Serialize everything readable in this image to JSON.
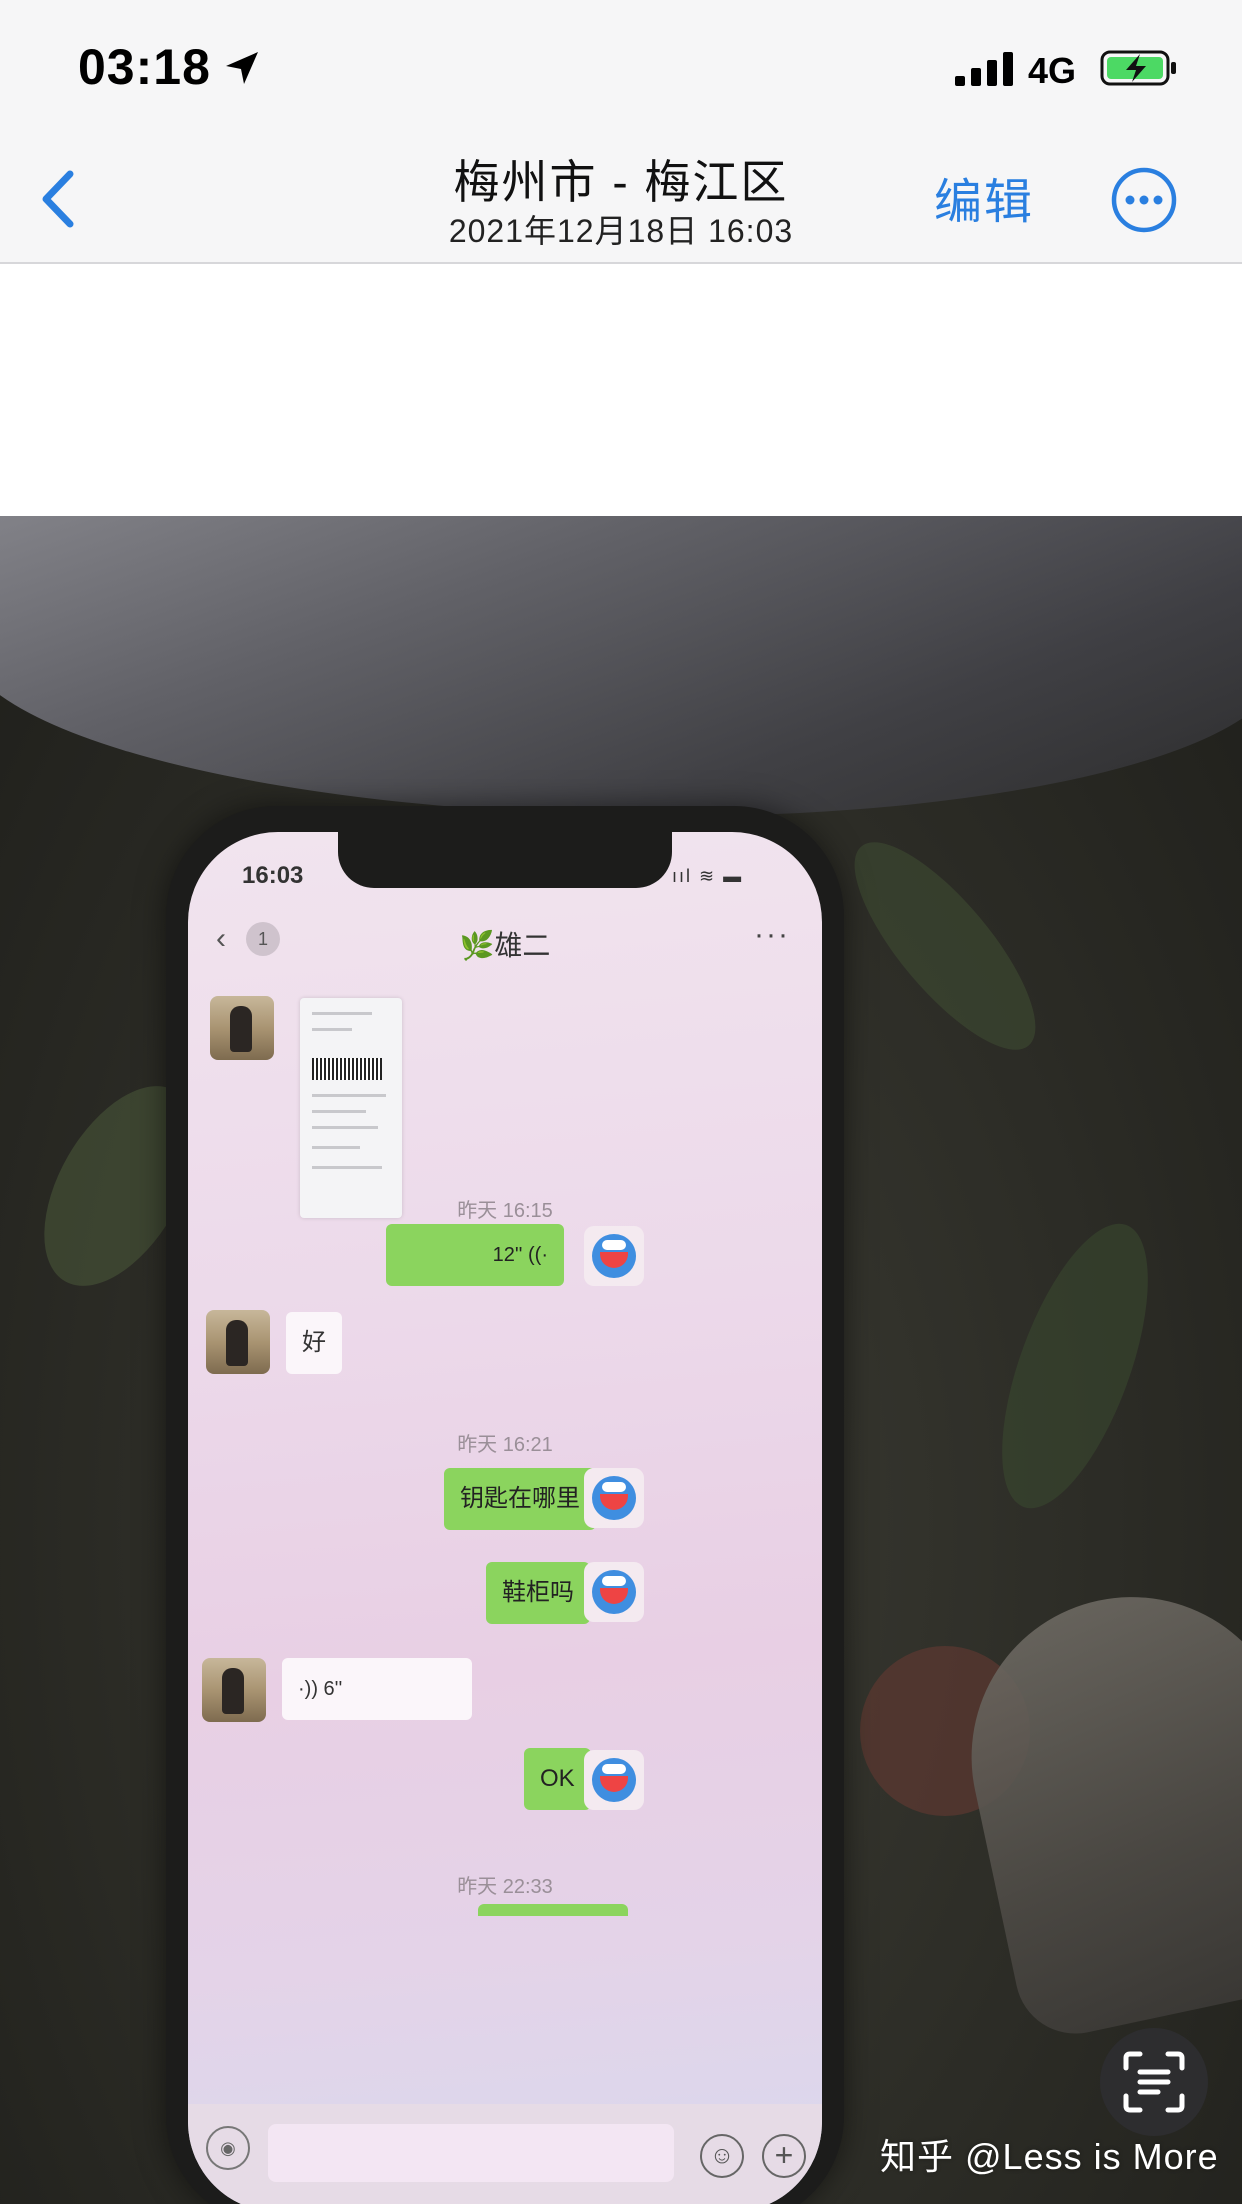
{
  "status_bar": {
    "time": "03:18",
    "network": "4G",
    "location_icon": "location-arrow-icon",
    "signal_icon": "cellular-signal-icon",
    "battery_icon": "battery-charging-icon"
  },
  "nav": {
    "back_icon": "chevron-left-icon",
    "title": "梅州市 - 梅江区",
    "subtitle": "2021年12月18日  16:03",
    "edit_label": "编辑",
    "more_icon": "ellipsis-circle-icon",
    "accent_color": "#2a7fe0"
  },
  "photo": {
    "phone_screen": {
      "time": "16:03",
      "status": "ııl ≋ ▬",
      "back": "‹",
      "unread_badge": "1",
      "contact": "🌿雄二",
      "more": "···",
      "messages": [
        {
          "kind": "timestamp",
          "text": "昨天 16:15"
        },
        {
          "kind": "me-voice",
          "text": "12'' ((·"
        },
        {
          "kind": "other-text",
          "text": "好"
        },
        {
          "kind": "timestamp",
          "text": "昨天 16:21"
        },
        {
          "kind": "me-text",
          "text": "钥匙在哪里"
        },
        {
          "kind": "me-text",
          "text": "鞋柜吗"
        },
        {
          "kind": "other-voice",
          "text": "·)) 6''"
        },
        {
          "kind": "me-text",
          "text": "OK"
        },
        {
          "kind": "timestamp",
          "text": "昨天 22:33"
        }
      ],
      "bubble_color": "#8bd45e"
    }
  },
  "overlay": {
    "live_text_icon": "live-text-scan-icon",
    "watermark": "知乎 @Less is More"
  }
}
